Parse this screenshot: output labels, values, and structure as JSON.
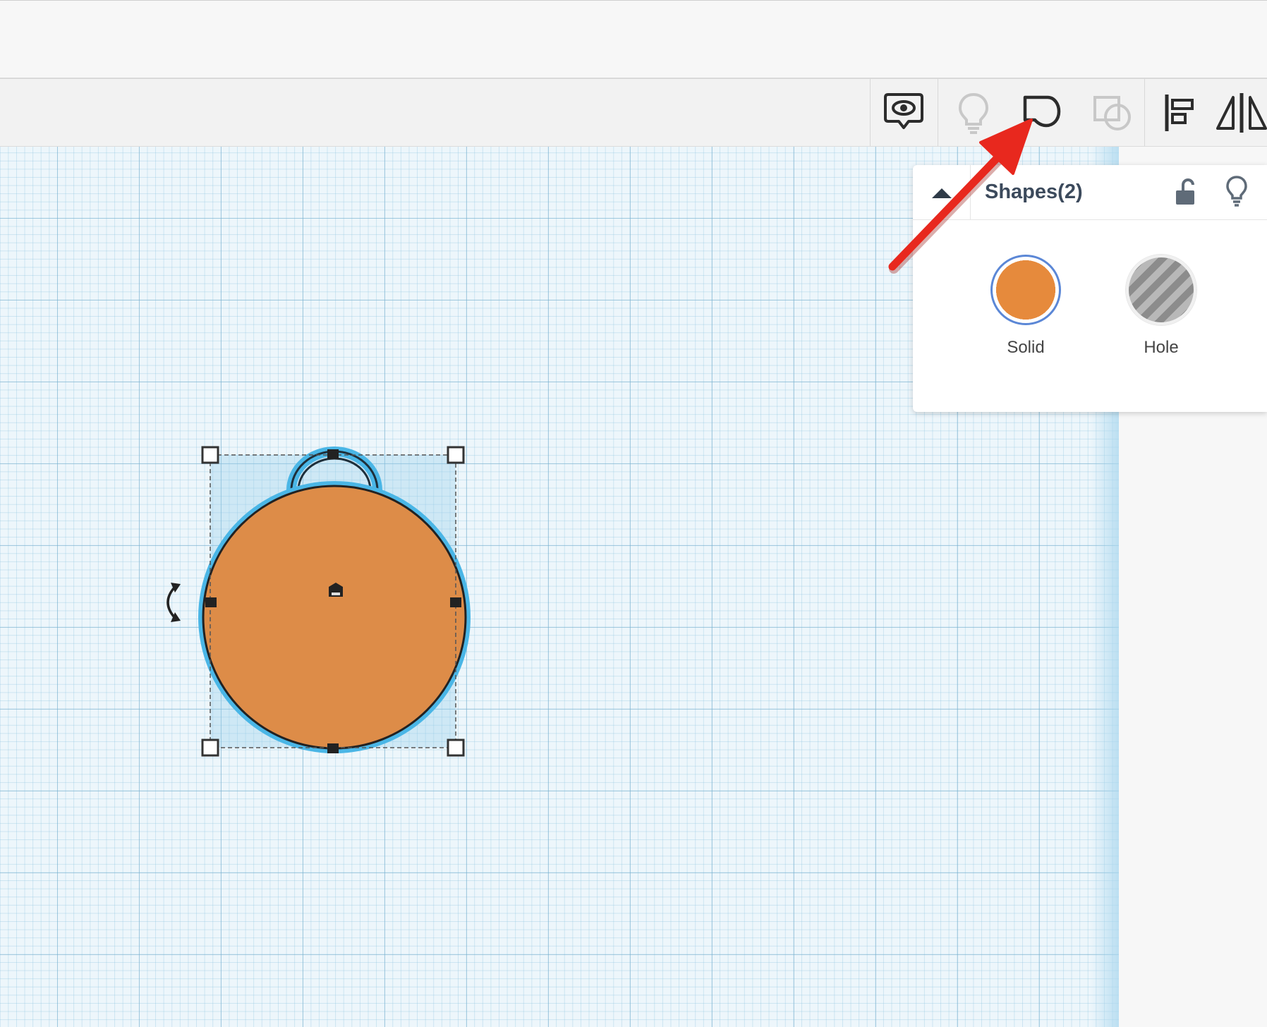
{
  "toolbar": {
    "buttons": [
      {
        "name": "notes-icon",
        "enabled": true
      },
      {
        "name": "lightbulb-icon",
        "enabled": false
      },
      {
        "name": "group-icon",
        "enabled": true
      },
      {
        "name": "ungroup-icon",
        "enabled": false
      },
      {
        "name": "align-icon",
        "enabled": true
      },
      {
        "name": "mirror-icon",
        "enabled": true
      }
    ]
  },
  "inspector": {
    "title": "Shapes(2)",
    "solid_label": "Solid",
    "hole_label": "Hole",
    "selected": "Solid"
  },
  "colors": {
    "shape_fill": "#dd8c48",
    "selection_outline": "#4ab6e6",
    "solid_swatch": "#e68a3c",
    "annotation_arrow": "#e8281e",
    "panel_title": "#3c4a5c"
  }
}
